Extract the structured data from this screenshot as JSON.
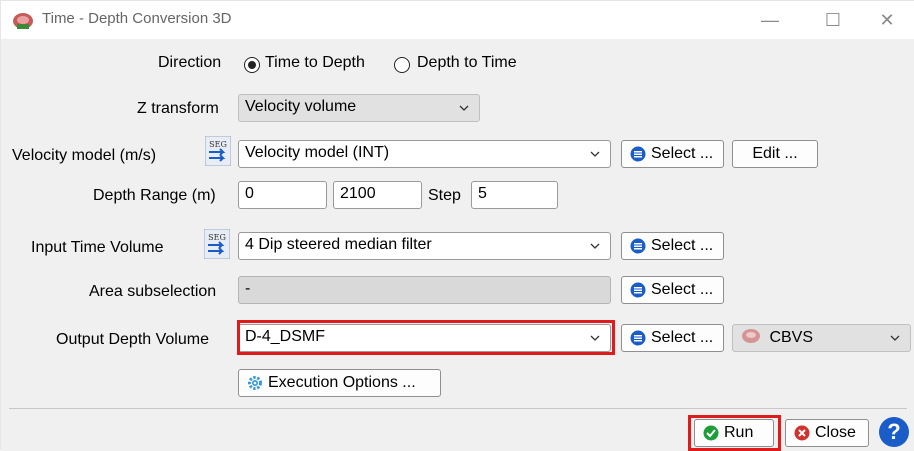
{
  "window": {
    "title": "Time - Depth Conversion 3D",
    "minimize": "—",
    "maximize": "☐",
    "close": "✕"
  },
  "direction": {
    "label": "Direction",
    "option_1": "Time to Depth",
    "option_2": "Depth to Time",
    "selected": "Time to Depth"
  },
  "z_transform": {
    "label": "Z transform",
    "value": "Velocity volume"
  },
  "velocity_model": {
    "label": "Velocity model (m/s)",
    "value": "Velocity model (INT)",
    "select_label": "Select ...",
    "edit_label": "Edit ..."
  },
  "depth_range": {
    "label": "Depth Range (m)",
    "start": "0",
    "stop": "2100",
    "step_label": "Step",
    "step": "5"
  },
  "input_time_volume": {
    "label": "Input Time Volume",
    "value": "4 Dip steered median filter",
    "select_label": "Select ..."
  },
  "area_subselection": {
    "label": "Area subselection",
    "value": "-",
    "select_label": "Select ..."
  },
  "output_depth_volume": {
    "label": "Output Depth Volume",
    "value": "D-4_DSMF",
    "select_label": "Select ...",
    "format": "CBVS"
  },
  "execution_options_label": "Execution Options ...",
  "footer": {
    "run_label": "Run",
    "close_label": "Close",
    "help_label": "?"
  },
  "icons": {
    "seg": "SEG",
    "seg_import": "seg-import-icon"
  },
  "colors": {
    "highlight": "#e01b1b",
    "select_icon": "#1a5cc8",
    "run_icon": "#1e9e3a",
    "close_icon": "#d0322d"
  }
}
